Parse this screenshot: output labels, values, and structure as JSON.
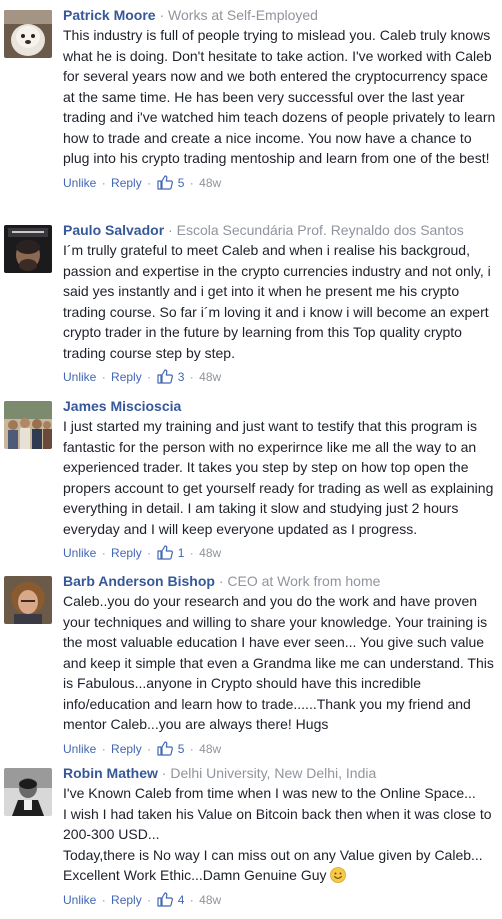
{
  "comments": [
    {
      "name": "Patrick Moore",
      "work": "Works at Self-Employed",
      "body": [
        "This industry is full of people trying to mislead you. Caleb truly knows what he is doing. Don't hesitate to take action. I've worked with Caleb for several years now and we both entered the cryptocurrency space at the same time. He has been very successful over the last year trading and i've watched him teach dozens of people privately to learn how to trade and create a nice income. You now have a chance to plug into his crypto trading mentoship and learn from one of the best!"
      ],
      "unlike": "Unlike",
      "reply": "Reply",
      "likes": "5",
      "time": "48w"
    },
    {
      "name": "Paulo Salvador",
      "work": "Escola Secundária Prof. Reynaldo dos Santos",
      "body": [
        "I´m trully grateful to meet Caleb and when i realise his backgroud, passion and expertise in the crypto currencies industry and not only, i said yes instantly and i get into it when he present me his crypto trading course. So far i´m loving it and i know i will become an expert crypto trader in the future by learning from this Top quality crypto trading course step by step."
      ],
      "unlike": "Unlike",
      "reply": "Reply",
      "likes": "3",
      "time": "48w"
    },
    {
      "name": "James Miscioscia",
      "work": "",
      "body": [
        "I just started my training and just want to testify that this program is fantastic for the person with no experirnce like me all the way to an experienced trader. It takes you step by step on how top open the propers account to get yourself ready for trading as well as explaining everything in detail. I am taking it slow and studying just 2 hours everyday and I will keep everyone updated as I progress."
      ],
      "unlike": "Unlike",
      "reply": "Reply",
      "likes": "1",
      "time": "48w"
    },
    {
      "name": "Barb Anderson Bishop",
      "work": "CEO at Work from home",
      "body": [
        "Caleb..you do your research and you do the work and have proven your techniques and willing to share your knowledge. Your training is the most valuable education I have ever seen... You give such value and keep it simple that even a Grandma like me can understand. This is Fabulous...anyone in Crypto should have this incredible info/education and learn how to trade......Thank you my friend and mentor Caleb...you are always there! Hugs"
      ],
      "unlike": "Unlike",
      "reply": "Reply",
      "likes": "5",
      "time": "48w"
    },
    {
      "name": "Robin Mathew",
      "work": "Delhi University, New Delhi, India",
      "body": [
        "I've Known Caleb from time when I was new to the Online Space...",
        "I wish I had taken his Value on Bitcoin back then when it was close to 200-300 USD...",
        "Today,there is No way I can miss out on any Value given by Caleb...",
        "Excellent Work Ethic...Damn Genuine Guy"
      ],
      "unlike": "Unlike",
      "reply": "Reply",
      "likes": "4",
      "time": "48w"
    }
  ],
  "separator": "·",
  "colors": {
    "name": "#365899",
    "link": "#4267b2",
    "meta": "#90949c",
    "text": "#1d2129"
  },
  "icons": {
    "like": "thumbs-up-icon",
    "emoji": "smiley-emoji-icon"
  }
}
